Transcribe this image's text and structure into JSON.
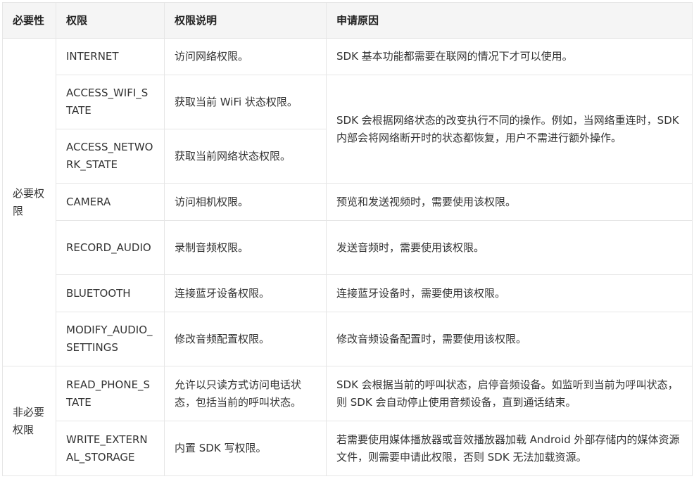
{
  "headers": [
    "必要性",
    "权限",
    "权限说明",
    "申请原因"
  ],
  "groups": {
    "required": "必要权限",
    "optional": "非必要权限"
  },
  "rows": [
    {
      "perm": "INTERNET",
      "desc": "访问网络权限。",
      "reason": "SDK 基本功能都需要在联网的情况下才可以使用。"
    },
    {
      "perm": "ACCESS_WIFI_STATE",
      "desc": "获取当前 WiFi 状态权限。",
      "reason": "SDK 会根据网络状态的改变执行不同的操作。例如，当网络重连时，SDK 内部会将网络断开时的状态都恢复，用户不需进行额外操作。"
    },
    {
      "perm": "ACCESS_NETWORK_STATE",
      "desc": "获取当前网络状态权限。"
    },
    {
      "perm": "CAMERA",
      "desc": "访问相机权限。",
      "reason": "预览和发送视频时，需要使用该权限。"
    },
    {
      "perm": "RECORD_AUDIO",
      "desc": "录制音频权限。",
      "reason": "发送音频时，需要使用该权限。"
    },
    {
      "perm": "BLUETOOTH",
      "desc": "连接蓝牙设备权限。",
      "reason": "连接蓝牙设备时，需要使用该权限。"
    },
    {
      "perm": "MODIFY_AUDIO_SETTINGS",
      "desc": "修改音频配置权限。",
      "reason": "修改音频设备配置时，需要使用该权限。"
    },
    {
      "perm": "READ_PHONE_STATE",
      "desc": "允许以只读方式访问电话状态，包括当前的呼叫状态。",
      "reason": "SDK 会根据当前的呼叫状态，启停音频设备。如监听到当前为呼叫状态，则 SDK 会自动停止使用音频设备，直到通话结束。"
    },
    {
      "perm": "WRITE_EXTERNAL_STORAGE",
      "desc": "内置 SDK 写权限。",
      "reason": "若需要使用媒体播放器或音效播放器加载 Android 外部存储内的媒体资源文件，则需要申请此权限，否则 SDK 无法加载资源。"
    }
  ]
}
